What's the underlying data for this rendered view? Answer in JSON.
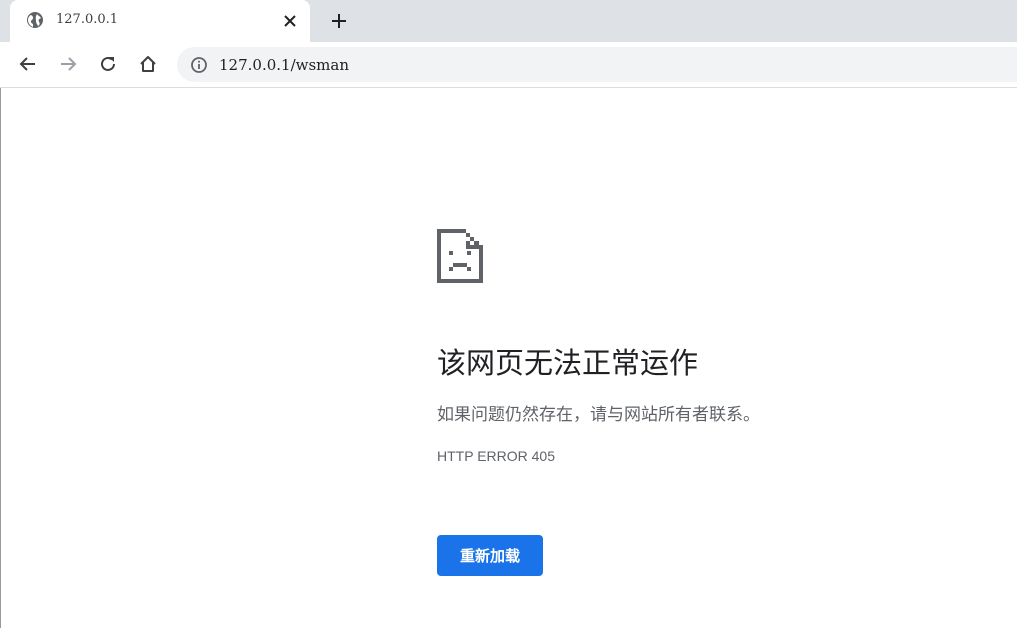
{
  "tab": {
    "title": "127.0.0.1",
    "favicon": "globe-icon"
  },
  "toolbar": {
    "back_icon": "back-arrow-icon",
    "forward_icon": "forward-arrow-icon",
    "reload_icon": "reload-icon",
    "home_icon": "home-icon"
  },
  "omnibox": {
    "url": "127.0.0.1/wsman",
    "info_icon": "info-icon"
  },
  "error": {
    "icon": "sad-page-icon",
    "title": "该网页无法正常运作",
    "subtitle": "如果问题仍然存在，请与网站所有者联系。",
    "code": "HTTP ERROR 405",
    "reload_label": "重新加载"
  },
  "colors": {
    "tabstrip": "#dee1e6",
    "omnibox": "#f1f3f4",
    "accent": "#1a73e8"
  }
}
